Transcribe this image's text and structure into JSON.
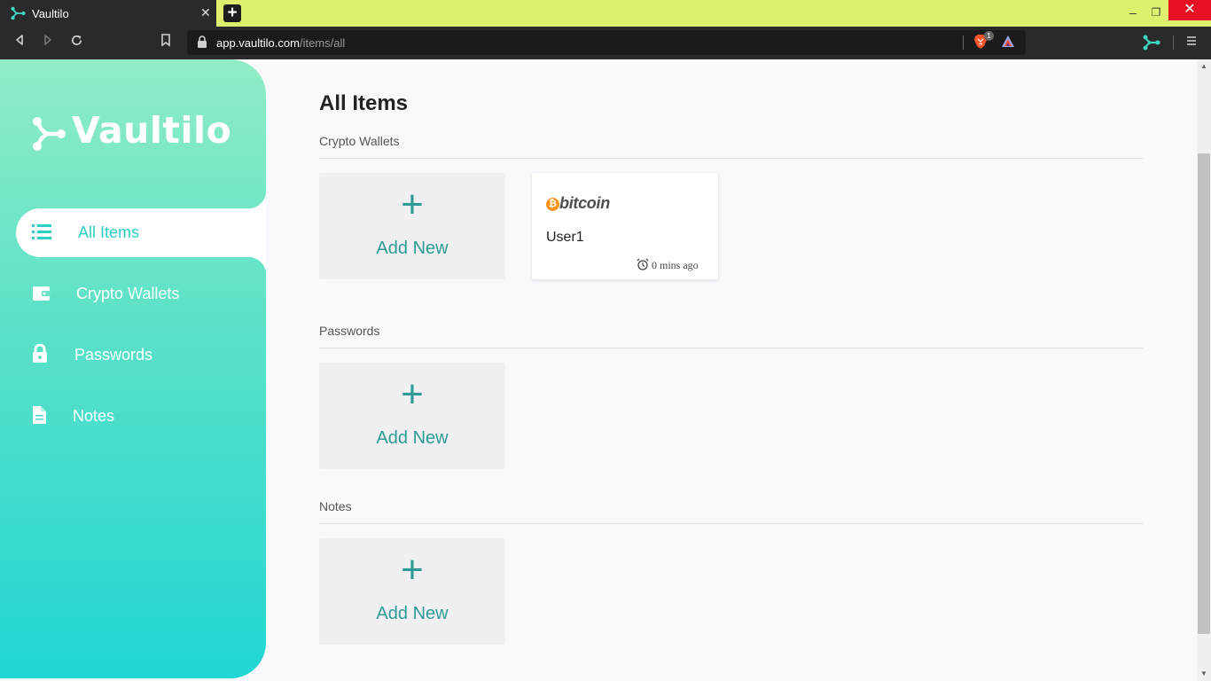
{
  "browser": {
    "tab_title": "Vaultilo",
    "url_host": "app.vaultilo.com",
    "url_path": "/items/all",
    "shields_count": "1",
    "window_buttons": {
      "minimize": "–",
      "restore": "❐",
      "close": "✕"
    }
  },
  "sidebar": {
    "brand": "Vaultilo",
    "items": [
      {
        "label": "All Items",
        "icon": "list-icon",
        "active": true
      },
      {
        "label": "Crypto Wallets",
        "icon": "wallet-icon",
        "active": false
      },
      {
        "label": "Passwords",
        "icon": "lock-icon",
        "active": false
      },
      {
        "label": "Notes",
        "icon": "document-icon",
        "active": false
      }
    ]
  },
  "main": {
    "title": "All Items",
    "sections": [
      {
        "title": "Crypto Wallets",
        "add_label": "Add New",
        "plus": "+"
      },
      {
        "title": "Passwords",
        "add_label": "Add New",
        "plus": "+"
      },
      {
        "title": "Notes",
        "add_label": "Add New",
        "plus": "+"
      }
    ],
    "wallet_item": {
      "logo_text": "bitcoin",
      "logo_symbol": "₿",
      "name": "User1",
      "time": "0 mins ago"
    }
  },
  "colors": {
    "accent": "#2bcfc6",
    "sidebar_top": "#91ecc6",
    "sidebar_bottom": "#21d6d3",
    "add_text": "#2e9c94",
    "tabbar": "#dff06e",
    "bitcoin": "#f7931a"
  }
}
